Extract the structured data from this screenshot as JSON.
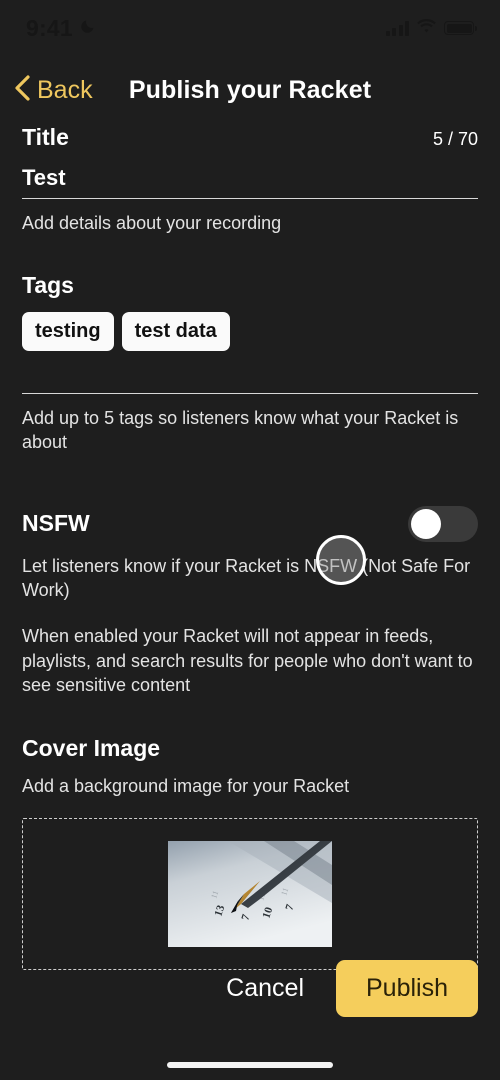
{
  "status_bar": {
    "time": "9:41",
    "dnd_icon": "crescent-moon-icon",
    "signal_icon": "cellular-signal-icon",
    "wifi_icon": "wifi-icon",
    "battery_icon": "battery-full-icon"
  },
  "nav": {
    "back_label": "Back",
    "back_icon": "chevron-left-icon",
    "title": "Publish your Racket"
  },
  "title_section": {
    "label": "Title",
    "counter": "5 / 70",
    "value": "Test",
    "placeholder": "Title",
    "helper": "Add details about your recording"
  },
  "tags_section": {
    "label": "Tags",
    "chips": [
      "testing",
      "test data"
    ],
    "input_placeholder": "",
    "helper": "Add up to 5 tags so listeners know what your Racket is about"
  },
  "nsfw_section": {
    "label": "NSFW",
    "toggle_state": "off",
    "description": "Let listeners know if your Racket is NSFW (Not Safe For Work)",
    "detail": "When enabled your Racket will not appear in feeds, playlists, and search results for people who don't want to see sensitive content"
  },
  "cover_section": {
    "label": "Cover Image",
    "helper": "Add a background image for your Racket",
    "thumbnail_alt": "pencil tip writing numbers on paper"
  },
  "actions": {
    "cancel_label": "Cancel",
    "publish_label": "Publish"
  },
  "colors": {
    "background": "#1e1e1e",
    "accent": "#efc75e",
    "publish_button": "#f5ce5c",
    "chip_background": "#fafafa"
  }
}
